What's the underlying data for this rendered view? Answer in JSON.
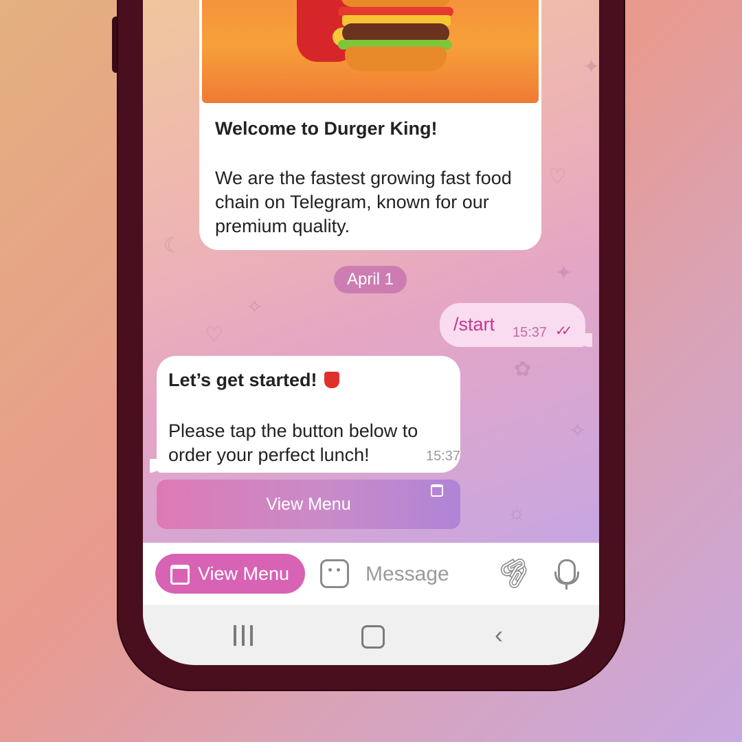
{
  "card": {
    "title": "Welcome to Durger King!",
    "body": "We are the fastest growing fast food chain on Telegram, known for our premium quality."
  },
  "date_separator": "April 1",
  "outgoing_message": {
    "text": "/start",
    "time": "15:37",
    "status_icon": "double-check-icon"
  },
  "incoming_message": {
    "title": "Let’s get started!",
    "emoji": "fries-emoji",
    "body": "Please tap the button below to order your perfect lunch!",
    "time": "15:37"
  },
  "inline_button": {
    "label": "View Menu",
    "icon": "web-app-icon"
  },
  "input_bar": {
    "menu_button_label": "View Menu",
    "menu_button_icon": "web-app-icon",
    "sticker_icon": "sticker-icon",
    "placeholder": "Message",
    "attach_icon": "paperclip-icon",
    "mic_icon": "microphone-icon"
  },
  "nav_bar": {
    "recent_icon": "recent-apps-icon",
    "home_icon": "home-icon",
    "back_icon": "back-icon"
  },
  "colors": {
    "accent": "#d862b4",
    "outgoing_bubble": "#f9dcef",
    "outgoing_text": "#c23a8e",
    "date_pill": "#be64aa",
    "phone_frame": "#4a0f1f"
  }
}
